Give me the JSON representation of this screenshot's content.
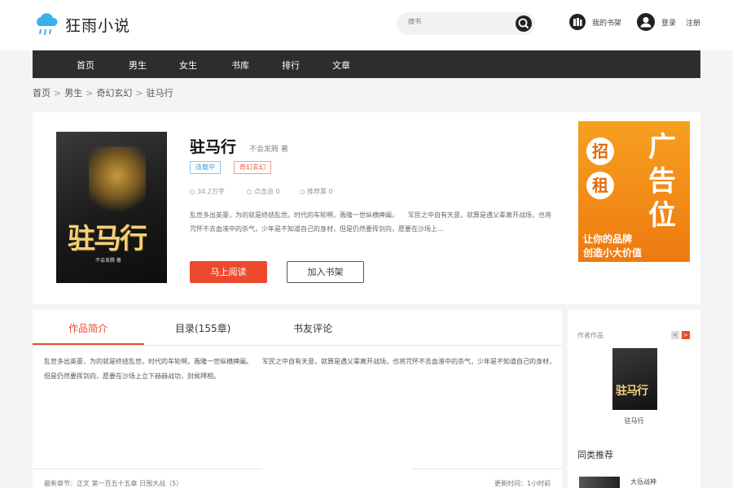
{
  "header": {
    "site_name": "狂雨小说",
    "search_placeholder": "搜书",
    "my_shelf": "我的书架",
    "login": "登录",
    "register": "注册"
  },
  "nav": {
    "items": [
      "首页",
      "男生",
      "女生",
      "书库",
      "排行",
      "文章"
    ]
  },
  "breadcrumb": {
    "items": [
      "首页",
      "男生",
      "奇幻玄幻",
      "驻马行"
    ],
    "separator": ">"
  },
  "book": {
    "title": "驻马行",
    "author": "不会发腾 著",
    "cover_title": "驻马行",
    "cover_author": "不会发腾 著",
    "status_badge": "连载中",
    "tag_badge": "奇幻玄幻",
    "stats": [
      "34.2万字",
      "点击总 0",
      "推荐票 0"
    ],
    "summary": "乱世多出英豪，为的就是终结乱世。时代的车轮啊，轰隆一世纵横捭阖。　　军民之中自有天意，就算是遇父辈离开战场，也将咒怀不去血液中的杀气，少年是不知道自己的身材，但是仍然要挥剑向，愿要在沙场上...",
    "read_button": "马上阅读",
    "shelf_button": "加入书架"
  },
  "ad": {
    "circle_1": "招",
    "circle_2": "租",
    "big_1": "广",
    "big_2": "告",
    "big_3": "位",
    "line_1": "让你的品牌",
    "line_2": "创造小大价值",
    "colors": {
      "top": "#f6a020",
      "bottom": "#ee7a10"
    }
  },
  "tabs": {
    "items": [
      "作品简介",
      "目录(155章)",
      "书友评论"
    ],
    "active_index": 0,
    "intro": "乱世多出英豪，为的就是终结乱世。时代的车轮啊，轰隆一世纵横捭阖。　　军民之中自有天意，就算是遇父辈离开战场，也将咒怀不去血液中的杀气，少年是不知道自己的身材，但是仍然要挥剑向，愿要在沙场上立下赫赫战功，封侯拜相。",
    "latest_chapter": "最新章节：正文 第一百五十五章 日围大战（5）",
    "update_time": "更新时间：1小时前"
  },
  "sidebar": {
    "author_works_label": "作者作品",
    "pager_prev": "<",
    "pager_next": ">",
    "work_cover_title": "驻马行",
    "work_name": "驻马行",
    "similar_title": "同类推荐",
    "similar_item": "大岳战神"
  },
  "colors": {
    "accent": "#ec4a2e",
    "nav_bg": "#2d2d2d",
    "status_blue": "#3aa0d8"
  }
}
